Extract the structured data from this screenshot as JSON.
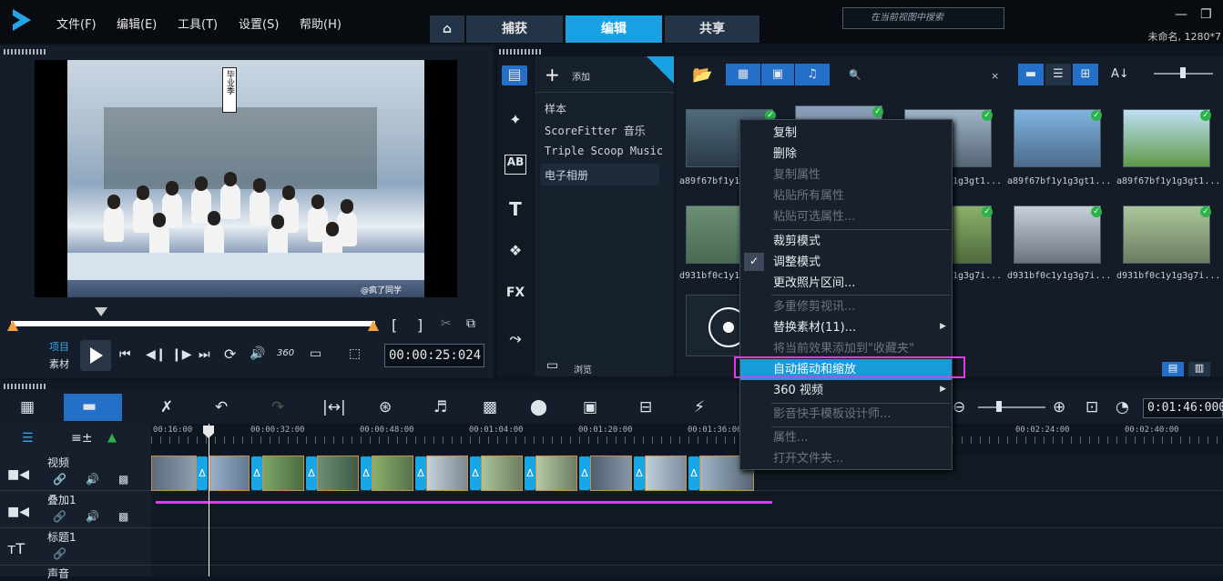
{
  "menu": {
    "file": "文件(F)",
    "edit": "编辑(E)",
    "tools": "工具(T)",
    "settings": "设置(S)",
    "help": "帮助(H)"
  },
  "mode_tabs": {
    "home_icon": "home-icon",
    "capture": "捕获",
    "edit": "编辑",
    "share": "共享",
    "active": "编辑"
  },
  "window": {
    "project_name": "未命名, 1280*7"
  },
  "player": {
    "project_label": "项目",
    "clip_label": "素材",
    "timecode": "00:00:25:024",
    "zoom_label": "360",
    "watermark": "@疯了同学",
    "sign_text": "毕业季"
  },
  "library": {
    "add_label": "添加",
    "browse_label": "浏览",
    "folders": [
      "样本",
      "ScoreFitter 音乐",
      "Triple Scoop Music",
      "电子相册"
    ],
    "selected_folder": "电子相册",
    "search_placeholder": "在当前视图中搜索",
    "thumbs": [
      {
        "label": "a89f67bf1y1"
      },
      {
        "label": ""
      },
      {
        "label": "1g3gt1..."
      },
      {
        "label": "a89f67bf1y1g3gt1..."
      },
      {
        "label": "a89f67bf1y1g3gt1..."
      },
      {
        "label": "d931bf0c1y1"
      },
      {
        "label": "1g3g7i..."
      },
      {
        "label": "d931bf0c1y1g3g7i..."
      },
      {
        "label": "d931bf0c1y1g3g7i..."
      }
    ]
  },
  "context_menu": {
    "copy": "复制",
    "delete": "删除",
    "copy_attr": "复制属性",
    "paste_all_attr": "粘贴所有属性",
    "paste_sel_attr": "粘贴可选属性...",
    "crop_mode": "裁剪模式",
    "adjust_mode": "调整模式",
    "change_range": "更改照片区间...",
    "multi_trim": "多重修剪视讯...",
    "replace": "替换素材(11)...",
    "add_fav": "将当前效果添加到\"收藏夹\"",
    "auto_pan": "自动摇动和缩放",
    "video360": "360 视频",
    "template": "影音快手模板设计师...",
    "props": "属性...",
    "open_folder": "打开文件夹..."
  },
  "timeline": {
    "timecode": "0:01:46:000",
    "ruler": [
      "00:16:00",
      "00:00:32:00",
      "00:00:48:00",
      "00:01:04:00",
      "00:01:20:00",
      "00:01:36:00",
      "00:02:24:00",
      "00:02:40:00"
    ],
    "tracks": {
      "video": "视频",
      "overlay": "叠加1",
      "title": "标题1",
      "voice": "声音"
    }
  }
}
